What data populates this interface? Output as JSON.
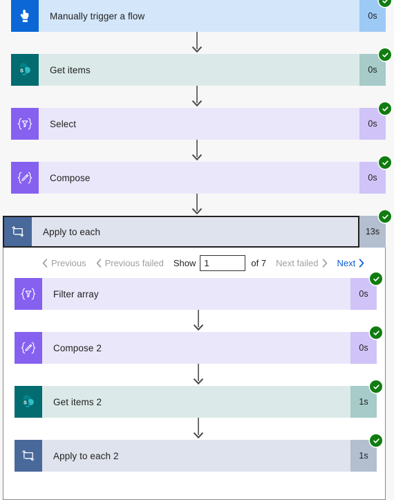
{
  "colors": {
    "page_background": "#f7f7f7",
    "scope_background": "#ffffff",
    "success_green": "#107c10",
    "link_blue": "#0b5cd5",
    "disabled_gray": "#a19f9d",
    "trigger_icon_bg": "#0b67d6",
    "trigger_card_bg": "#d3e6fa",
    "trigger_duration_bg": "#9dc9f5",
    "sharepoint_icon_bg": "#036c70",
    "sharepoint_card_bg": "#dbeae8",
    "sharepoint_duration_bg": "#a6cbc8",
    "dataop_icon_bg": "#8661f0",
    "dataop_card_bg": "#ebe7fb",
    "dataop_duration_bg": "#cfc3f7",
    "control_icon_bg": "#49699b",
    "control_card_bg": "#dfe3ee",
    "control_duration_bg": "#b3becf",
    "scope_border": "#201f1e",
    "connector_line": "#4a4a4a"
  },
  "flow": {
    "steps": [
      {
        "name": "Manually trigger a flow",
        "duration": "0s",
        "status": "succeeded",
        "icon": "touch-hand-icon",
        "icon_bg": "#0b67d6",
        "card_bg": "#d3e6fa",
        "duration_bg": "#9dc9f5"
      },
      {
        "name": "Get items",
        "duration": "0s",
        "status": "succeeded",
        "icon": "sharepoint-icon",
        "icon_bg": "#036c70",
        "card_bg": "#dbeae8",
        "duration_bg": "#a6cbc8"
      },
      {
        "name": "Select",
        "duration": "0s",
        "status": "succeeded",
        "icon": "select-funnel-icon",
        "icon_bg": "#8661f0",
        "card_bg": "#ebe7fb",
        "duration_bg": "#cfc3f7"
      },
      {
        "name": "Compose",
        "duration": "0s",
        "status": "succeeded",
        "icon": "compose-pencil-icon",
        "icon_bg": "#8661f0",
        "card_bg": "#ebe7fb",
        "duration_bg": "#cfc3f7"
      }
    ]
  },
  "scope": {
    "name": "Apply to each",
    "duration": "13s",
    "status": "succeeded",
    "icon": "apply-to-each-loop-icon",
    "icon_bg": "#49699b",
    "card_bg": "#dfe3ee",
    "duration_bg": "#b3becf",
    "selected": true,
    "pagination": {
      "previous_label": "Previous",
      "previous_failed_label": "Previous failed",
      "show_label": "Show",
      "page_value": "1",
      "page_placeholder": "",
      "of_label": "of 7",
      "total_pages": 7,
      "next_failed_label": "Next failed",
      "next_label": "Next",
      "previous_enabled": false,
      "previous_failed_enabled": false,
      "next_failed_enabled": false,
      "next_enabled": true
    },
    "steps": [
      {
        "name": "Filter array",
        "duration": "0s",
        "status": "succeeded",
        "icon": "filter-array-funnel-icon",
        "icon_bg": "#8661f0",
        "card_bg": "#ebe7fb",
        "duration_bg": "#cfc3f7"
      },
      {
        "name": "Compose 2",
        "duration": "0s",
        "status": "succeeded",
        "icon": "compose-pencil-icon",
        "icon_bg": "#8661f0",
        "card_bg": "#ebe7fb",
        "duration_bg": "#cfc3f7"
      },
      {
        "name": "Get items 2",
        "duration": "1s",
        "status": "succeeded",
        "icon": "sharepoint-icon",
        "icon_bg": "#036c70",
        "card_bg": "#dbeae8",
        "duration_bg": "#a6cbc8"
      },
      {
        "name": "Apply to each 2",
        "duration": "1s",
        "status": "succeeded",
        "icon": "apply-to-each-loop-icon",
        "icon_bg": "#49699b",
        "card_bg": "#dfe3ee",
        "duration_bg": "#b3becf"
      }
    ]
  }
}
